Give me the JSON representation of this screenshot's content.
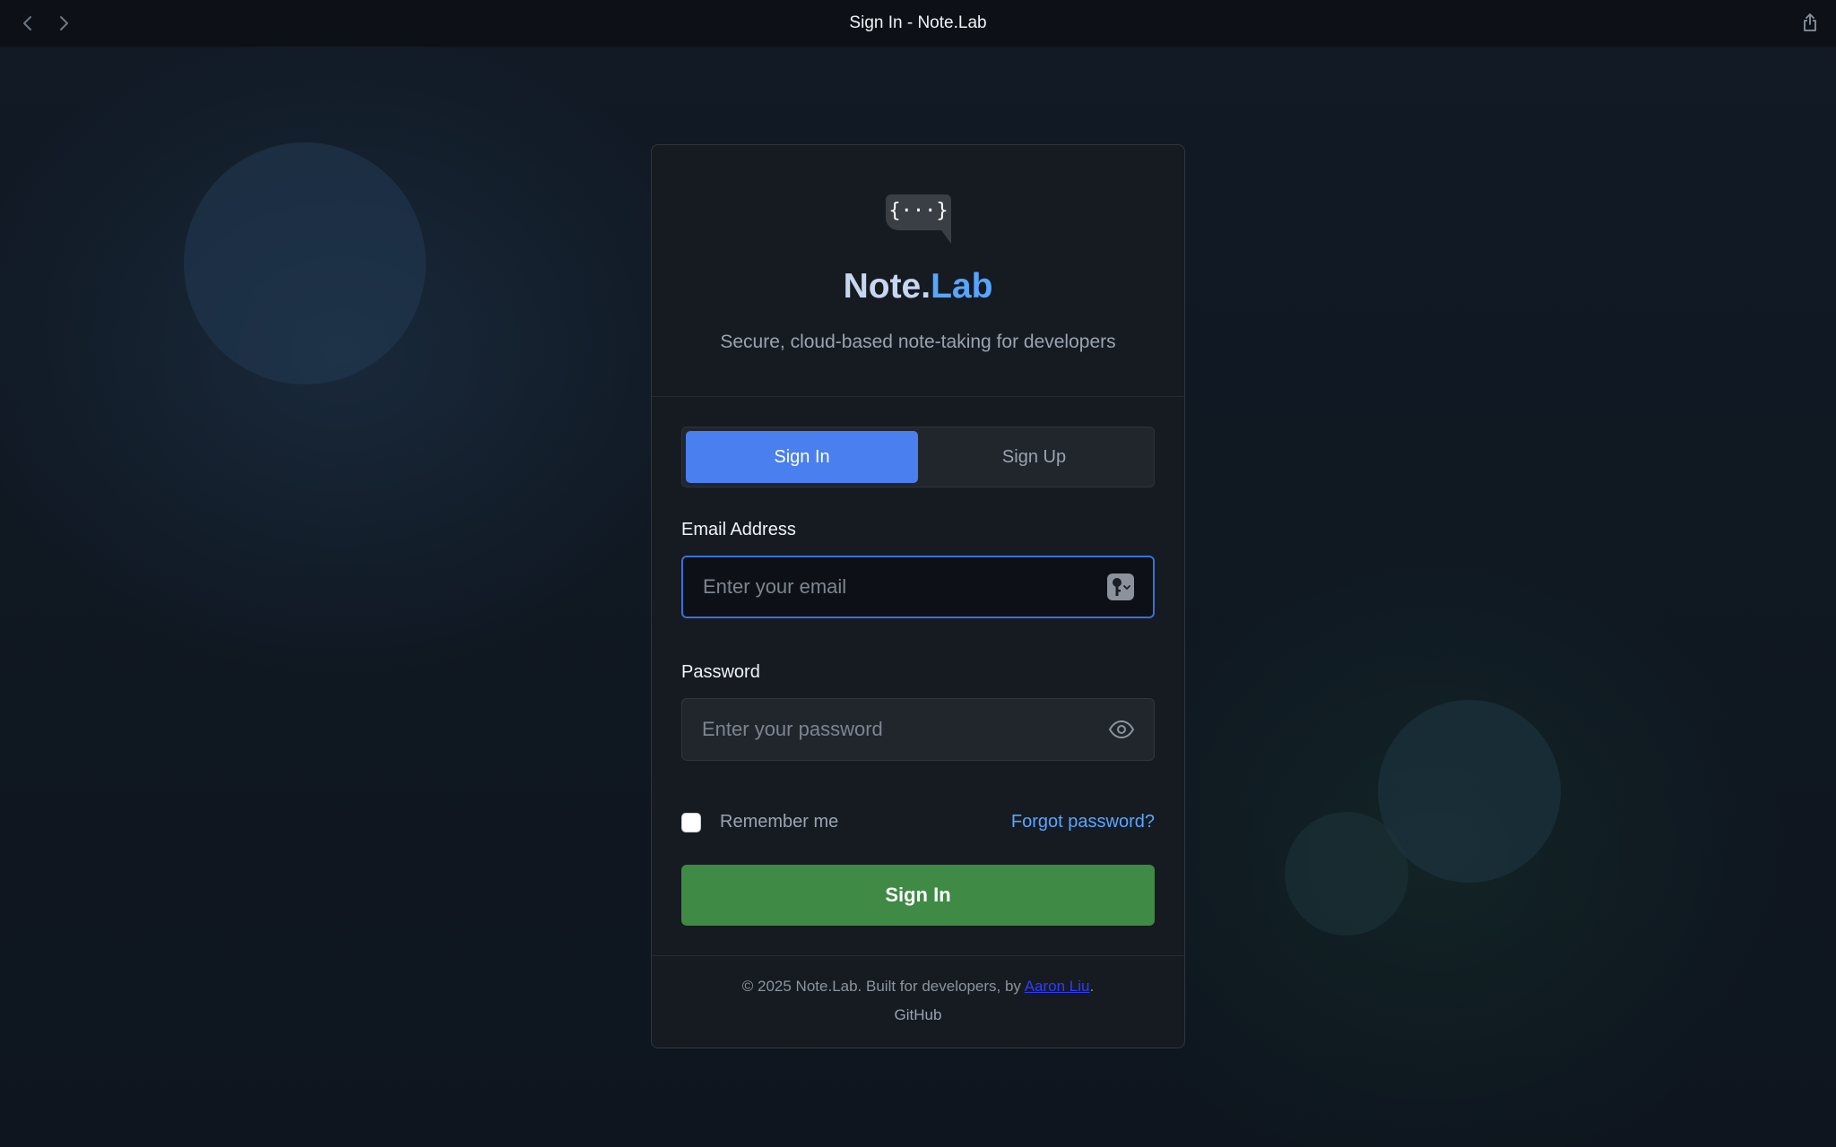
{
  "window": {
    "title": "Sign In - Note.Lab"
  },
  "icons": {
    "back": "chevron-left-icon",
    "forward": "chevron-right-icon",
    "share": "share-icon",
    "logo": "code-bubble-icon",
    "password_manager": "key-icon",
    "reveal_password": "eye-icon"
  },
  "brand": {
    "logo_glyph": "{···}",
    "name_part1": "Note.",
    "name_part2": "Lab",
    "tagline": "Secure, cloud-based note-taking for developers"
  },
  "tabs": [
    {
      "label": "Sign In",
      "active": true
    },
    {
      "label": "Sign Up",
      "active": false
    }
  ],
  "form": {
    "email_label": "Email Address",
    "email_placeholder": "Enter your email",
    "email_value": "",
    "password_label": "Password",
    "password_placeholder": "Enter your password",
    "password_value": "",
    "remember_label": "Remember me",
    "remember_checked": false,
    "forgot_label": "Forgot password?",
    "submit_label": "Sign In"
  },
  "footer": {
    "copyright_prefix": "© 2025 Note.Lab. Built for developers, by ",
    "author_link": "Aaron Liu",
    "copyright_suffix": ".",
    "github_label": "GitHub"
  },
  "colors": {
    "accent_blue": "#4a7ff0",
    "link_blue": "#58a6ff",
    "submit_green": "#3f8a45",
    "card_bg": "#161b22"
  }
}
